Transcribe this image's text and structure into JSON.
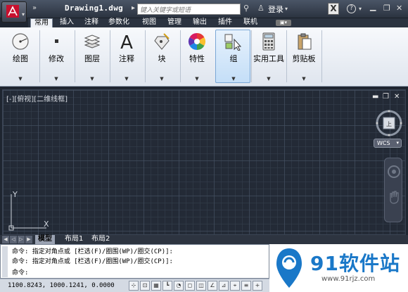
{
  "title_bar": {
    "doc_title": "Drawing1.dwg",
    "search_placeholder": "键入关键字或短语",
    "login_label": "登录",
    "help_label": "?"
  },
  "tabs": [
    "常用",
    "插入",
    "注释",
    "参数化",
    "视图",
    "管理",
    "输出",
    "插件",
    "联机"
  ],
  "ribbon_panels": [
    {
      "label": "绘图",
      "icon": "draw-circle-icon"
    },
    {
      "label": "修改",
      "icon": "modify-icon"
    },
    {
      "label": "图层",
      "icon": "layers-icon"
    },
    {
      "label": "注释",
      "icon": "annotation-text-icon"
    },
    {
      "label": "块",
      "icon": "block-icon"
    },
    {
      "label": "特性",
      "icon": "properties-color-wheel-icon"
    },
    {
      "label": "组",
      "icon": "group-icon"
    },
    {
      "label": "实用工具",
      "icon": "calculator-icon"
    },
    {
      "label": "剪贴板",
      "icon": "clipboard-icon"
    }
  ],
  "viewport": {
    "label": "[-][俯视][二维线框]",
    "compass_top": "上",
    "wcs_label": "WCS",
    "ucs_y": "Y",
    "ucs_x": "X"
  },
  "layout_tabs": [
    "模型",
    "布局1",
    "布局2"
  ],
  "command_lines": [
    "命令: 指定对角点或 [栏选(F)/圈围(WP)/圈交(CP)]:",
    "命令: 指定对角点或 [栏选(F)/圈围(WP)/圈交(CP)]:",
    "命令:"
  ],
  "status_bar": {
    "coordinates": "1100.8243, 1000.1241, 0.0000"
  },
  "watermark": {
    "name": "91软件站",
    "url": "www.91rjz.com"
  },
  "colors": {
    "viewport_bg": "#232a36",
    "selected_panel": "#c4def7",
    "accent_red": "#c8102e",
    "watermark_blue": "#1a78c8"
  }
}
